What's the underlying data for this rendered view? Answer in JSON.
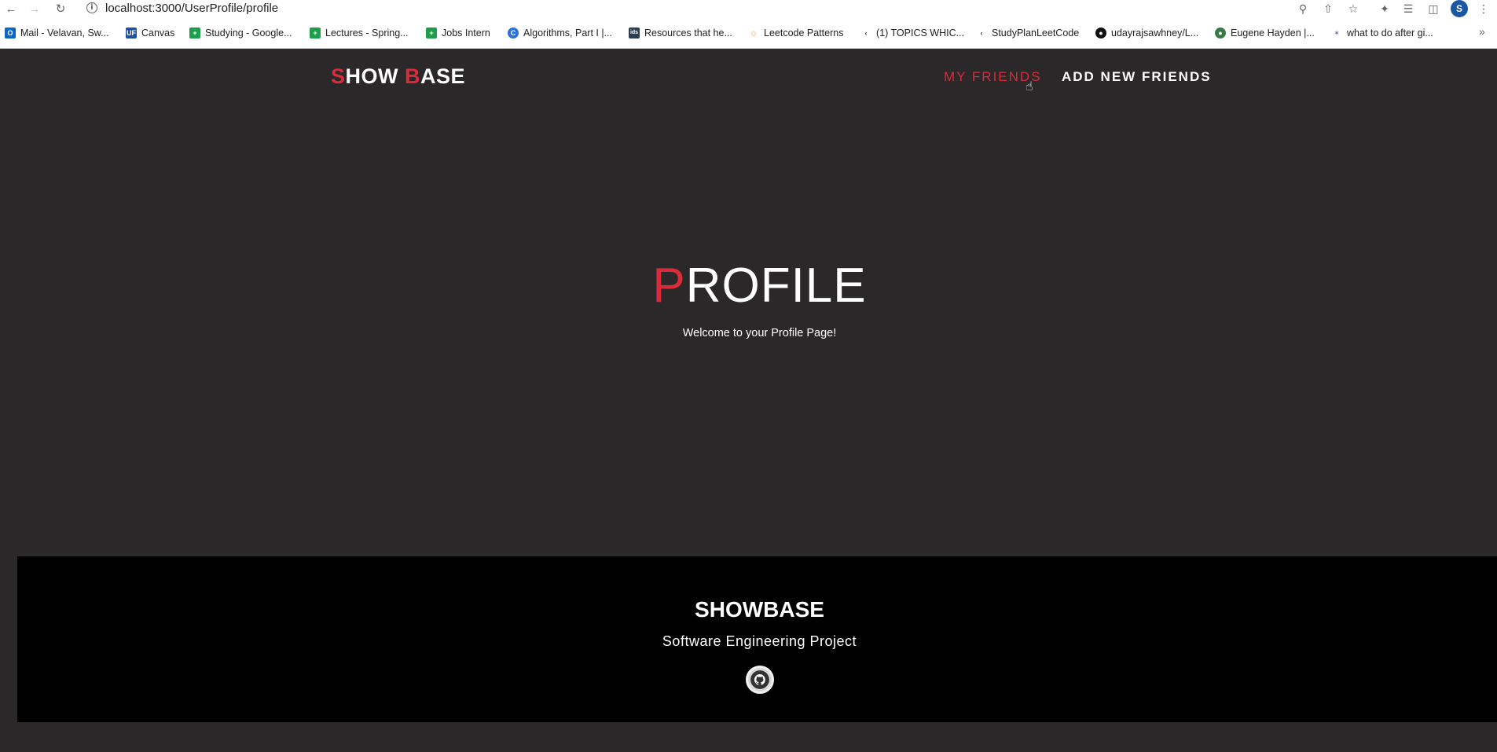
{
  "browser": {
    "url": "localhost:3000/UserProfile/profile",
    "avatar_initial": "S",
    "bookmarks": [
      {
        "label": "Mail - Velavan, Sw...",
        "icon": "outlook-icon",
        "color": "#0a66c2"
      },
      {
        "label": "Canvas",
        "icon": "uf-icon",
        "color": "#1f4fa0"
      },
      {
        "label": "Studying - Google...",
        "icon": "sheets-icon",
        "color": "#1e9e4a"
      },
      {
        "label": "Lectures - Spring...",
        "icon": "sheets-icon",
        "color": "#1e9e4a"
      },
      {
        "label": "Jobs Intern",
        "icon": "sheets-icon",
        "color": "#1e9e4a"
      },
      {
        "label": "Algorithms, Part I |...",
        "icon": "coursera-icon",
        "color": "#2a6fdb"
      },
      {
        "label": "Resources that he...",
        "icon": "ids-icon",
        "color": "#2d3e50"
      },
      {
        "label": "Leetcode Patterns",
        "icon": "leetcode-patterns-icon",
        "color": "#f0a030"
      },
      {
        "label": "(1) TOPICS WHIC...",
        "icon": "leetcode-icon",
        "color": "#333333"
      },
      {
        "label": "StudyPlanLeetCode",
        "icon": "leetcode-icon",
        "color": "#333333"
      },
      {
        "label": "udayrajsawhney/L...",
        "icon": "github-icon",
        "color": "#111111"
      },
      {
        "label": "Eugene Hayden |...",
        "icon": "profile-icon",
        "color": "#3a7a4a"
      },
      {
        "label": "what to do after gi...",
        "icon": "spark-icon",
        "color": "#7b5cc4"
      }
    ]
  },
  "site": {
    "brand_first": "S",
    "brand_mid": "HOW ",
    "brand_b": "B",
    "brand_rest": "ASE",
    "nav": {
      "my_friends": "MY FRIENDS",
      "add_new_friends": "ADD NEW FRIENDS"
    },
    "hero": {
      "title_first": "P",
      "title_rest": "ROFILE",
      "subtitle": "Welcome to your Profile Page!"
    },
    "footer": {
      "title": "SHOWBASE",
      "subtitle": "Software Engineering Project"
    },
    "colors": {
      "accent": "#d92b3a",
      "background": "#2a2829",
      "footer": "#000000"
    }
  }
}
